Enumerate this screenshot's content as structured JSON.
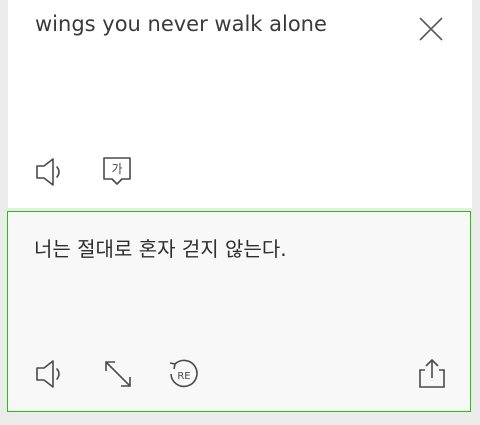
{
  "source": {
    "text": "wings you never walk alone",
    "icons": {
      "close": "close-icon",
      "speaker": "speaker-icon",
      "input_method": "hangul-input-icon",
      "input_method_glyph": "가"
    }
  },
  "result": {
    "text": "너는 절대로 혼자 걷지 않는다.",
    "icons": {
      "speaker": "speaker-icon",
      "expand": "expand-icon",
      "retranslate": "retranslate-icon",
      "retranslate_glyph": "RE",
      "share": "share-icon"
    }
  },
  "colors": {
    "accent_border": "#1ec800",
    "icon_stroke": "#4a4a4a",
    "source_bg": "#ffffff",
    "result_bg": "#f8f8f8",
    "page_bg": "#ebebeb"
  }
}
